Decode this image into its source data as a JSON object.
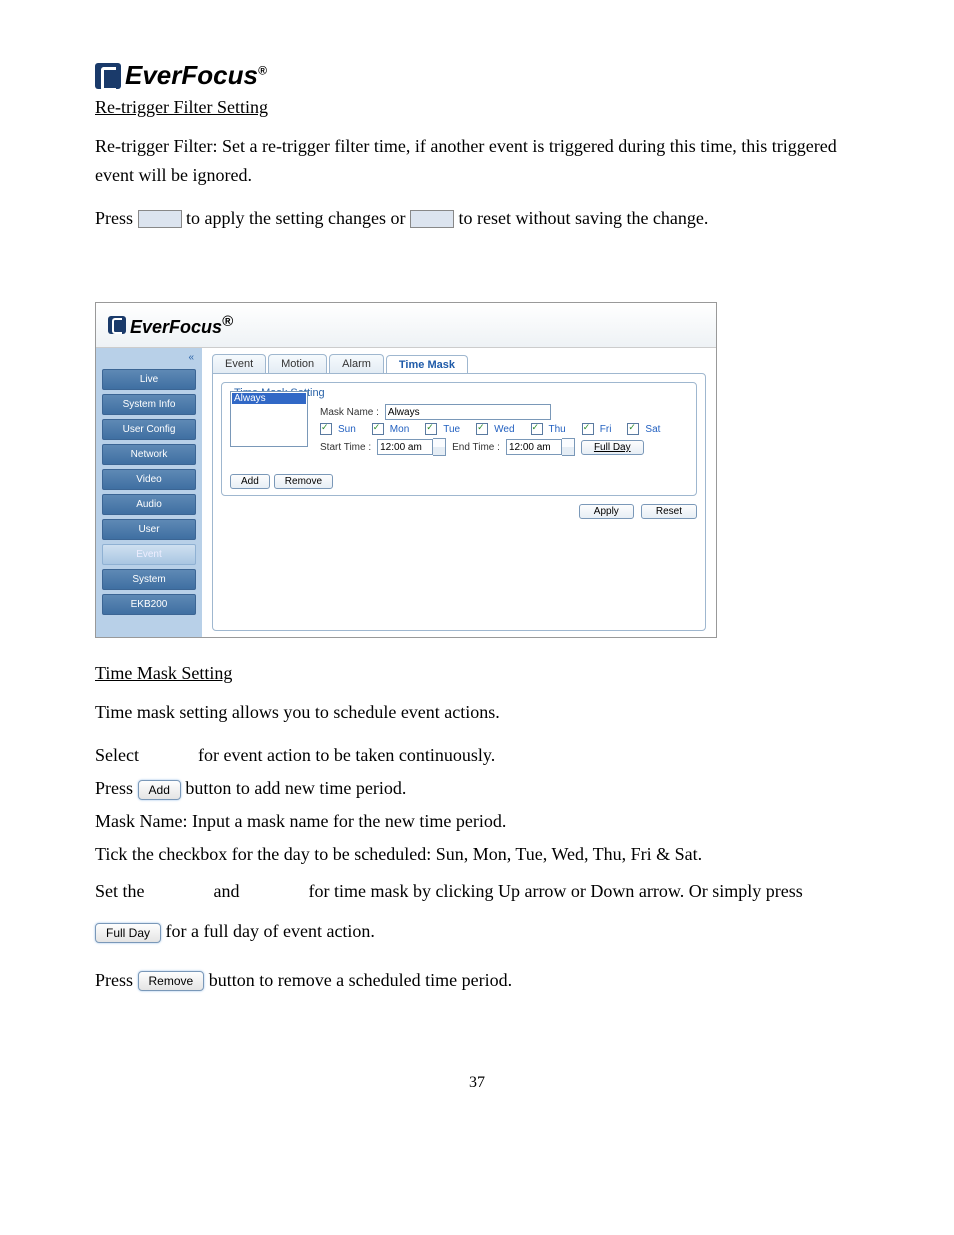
{
  "logo_text": "EverFocus",
  "logo_sup": "®",
  "section1_title": "Re-trigger Filter Setting",
  "para1": "Re-trigger Filter: Set a re-trigger filter time, if another event is triggered during this time, this triggered event will be ignored.",
  "press_line": {
    "a": "Press ",
    "b": " to apply the setting changes or ",
    "c": " to reset without saving the change."
  },
  "screenshot": {
    "brand": "EverFocus",
    "brand_sup": "®",
    "sidebar": [
      "Live",
      "System Info",
      "User Config",
      "Network",
      "Video",
      "Audio",
      "User",
      "Event",
      "System",
      "EKB200"
    ],
    "sidebar_selected": 7,
    "collapse_glyph": "«",
    "tabs": [
      "Event",
      "Motion",
      "Alarm",
      "Time Mask"
    ],
    "tab_active": 3,
    "fieldset_title": "Time Mask Setting",
    "list_option": "Always",
    "mask_name_label": "Mask Name :",
    "mask_name_value": "Always",
    "days": [
      "Sun",
      "Mon",
      "Tue",
      "Wed",
      "Thu",
      "Fri",
      "Sat"
    ],
    "start_label": "Start Time :",
    "start_val": "12:00 am",
    "end_label": "End Time :",
    "end_val": "12:00 am",
    "fullday_btn": "Full Day",
    "add_btn": "Add",
    "remove_btn": "Remove",
    "apply_btn": "Apply",
    "reset_btn": "Reset"
  },
  "section2_title": "Time Mask Setting",
  "para2": "Time mask setting allows you to schedule event actions.",
  "select_line_a": "Select ",
  "select_line_b": " for event action to be taken continuously.",
  "press_add_a": "Press ",
  "press_add_b": " button to add new time period.",
  "btn_add": "Add",
  "para_maskname": "Mask Name: Input a mask name for the new time period.",
  "para_tick": "Tick the checkbox for the day to be scheduled: Sun, Mon, Tue, Wed, Thu, Fri & Sat.",
  "set_line_a": "Set the ",
  "set_line_b": " and ",
  "set_line_c": " for time mask by clicking Up arrow or Down arrow. Or simply press ",
  "set_line_d": " for a full day of event action.",
  "btn_fullday": "Full Day",
  "press_remove_a": "Press ",
  "press_remove_b": " button to remove a scheduled time period.",
  "btn_remove": "Remove",
  "page_number": "37"
}
